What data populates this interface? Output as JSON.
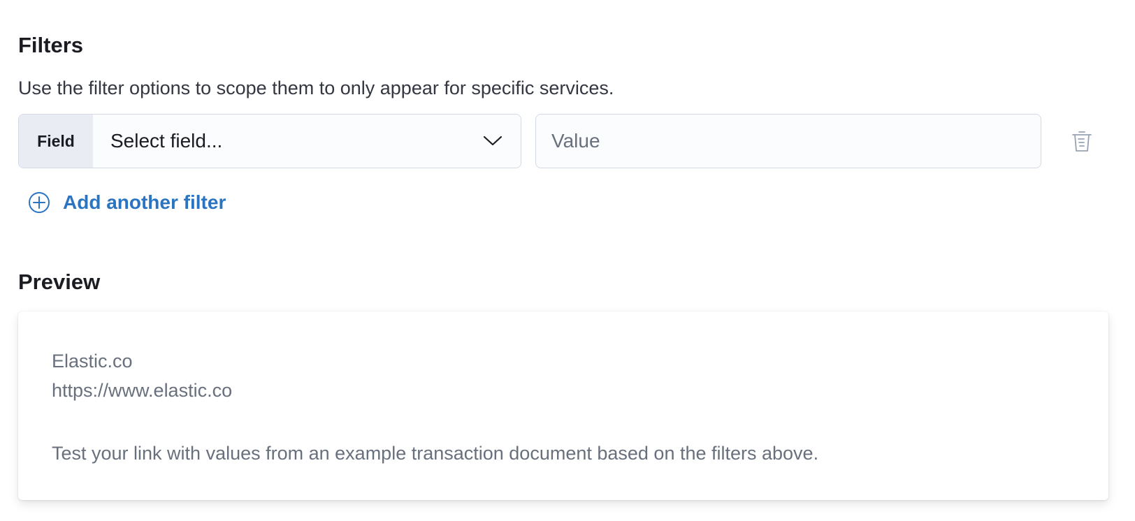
{
  "filters": {
    "title": "Filters",
    "description": "Use the filter options to scope them to only appear for specific services.",
    "rows": [
      {
        "field_prepend": "Field",
        "field_select_placeholder": "Select field...",
        "value_placeholder": "Value",
        "value": ""
      }
    ],
    "add_filter_label": "Add another filter",
    "icons": {
      "select": "chevron-down-icon",
      "remove": "trash-icon",
      "add": "plus-in-circle-icon"
    }
  },
  "preview": {
    "title": "Preview",
    "link_label": "Elastic.co",
    "link_url": "https://www.elastic.co",
    "help_text": "Test your link with values from an example transaction document based on the filters above."
  },
  "colors": {
    "accent_link": "#2a74c2",
    "text_primary": "#1a1c21",
    "text_subdued": "#69707d",
    "border": "#d3dae6"
  }
}
